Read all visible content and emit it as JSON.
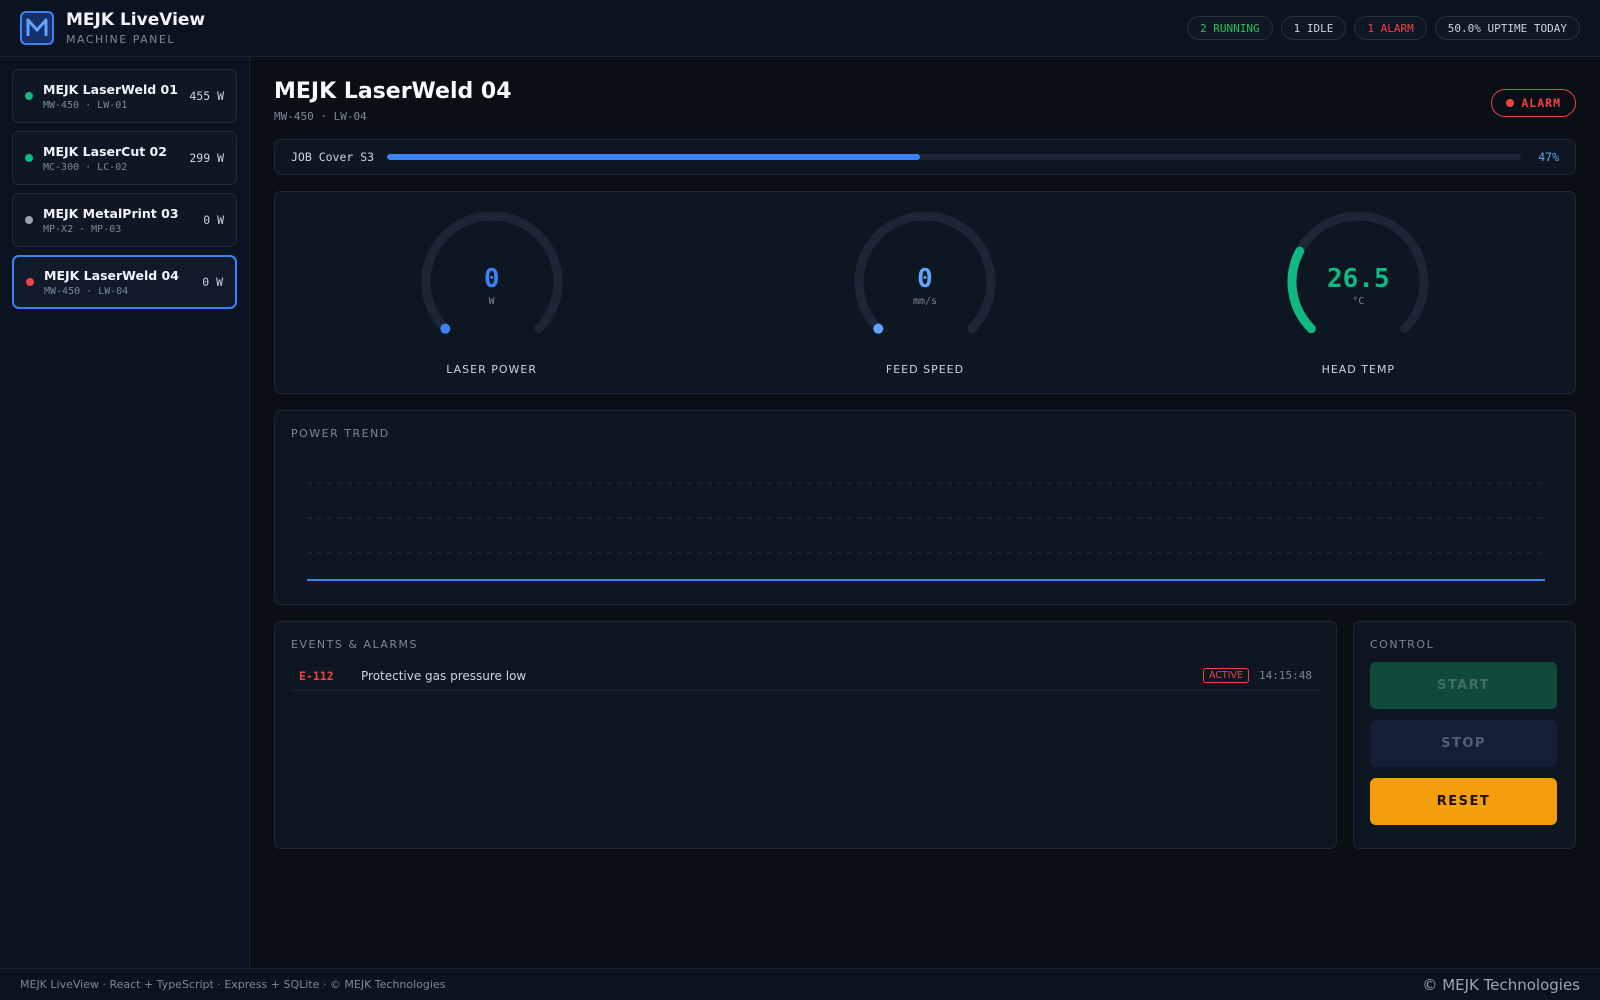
{
  "header": {
    "title": "MEJK LiveView",
    "subtitle": "MACHINE PANEL",
    "logo_letter": "M",
    "pills": {
      "running": "2 RUNNING",
      "idle": "1 IDLE",
      "alarm": "1 ALARM",
      "uptime": "50.0% UPTIME TODAY"
    }
  },
  "sidebar": {
    "machines": [
      {
        "name": "MEJK LaserWeld 01",
        "sub": "MW-450 · LW-01",
        "value": "455 W",
        "status_color": "#10b981"
      },
      {
        "name": "MEJK LaserCut 02",
        "sub": "MC-300 · LC-02",
        "value": "299 W",
        "status_color": "#10b981"
      },
      {
        "name": "MEJK MetalPrint 03",
        "sub": "MP-X2 · MP-03",
        "value": "0 W",
        "status_color": "#9ca3af"
      },
      {
        "name": "MEJK LaserWeld 04",
        "sub": "MW-450 · LW-04",
        "value": "0 W",
        "status_color": "#ef4444"
      }
    ]
  },
  "main": {
    "title": "MEJK LaserWeld 04",
    "subtitle": "MW-450 · LW-04",
    "status_badge": "ALARM",
    "job": {
      "label": "JOB Cover S3",
      "percent_text": "47%",
      "progress": 0.47
    },
    "gauges": [
      {
        "label": "LASER POWER",
        "value": "0",
        "unit": "W",
        "fraction": 0,
        "color": "#3b82f6"
      },
      {
        "label": "FEED SPEED",
        "value": "0",
        "unit": "mm/s",
        "fraction": 0,
        "color": "#60a5fa"
      },
      {
        "label": "HEAD TEMP",
        "value": "26.5",
        "unit": "°C",
        "fraction": 0.27,
        "color": "#10b981"
      }
    ],
    "trend": {
      "title": "POWER TREND"
    },
    "events": {
      "title": "EVENTS & ALARMS",
      "rows": [
        {
          "code": "E-112",
          "message": "Protective gas pressure low",
          "status": "ACTIVE",
          "time": "14:15:48"
        }
      ]
    },
    "control": {
      "title": "CONTROL",
      "start": "START",
      "stop": "STOP",
      "reset": "RESET"
    }
  },
  "footer": {
    "left": "MEJK LiveView · React + TypeScript · Express + SQLite · © MEJK Technologies",
    "right": "© MEJK Technologies"
  },
  "colors": {
    "accent": "#3b82f6",
    "running": "#22c55e",
    "alarm": "#ef4444",
    "reset": "#f59e0b"
  }
}
